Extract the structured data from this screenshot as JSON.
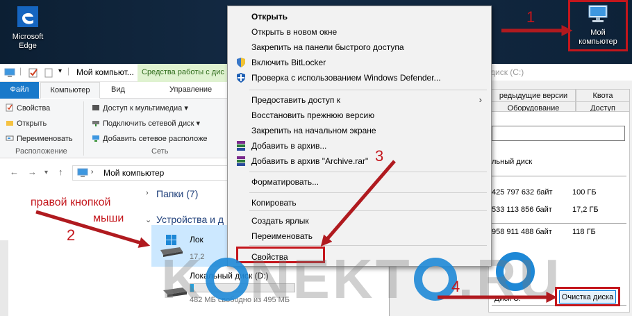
{
  "desktop": {
    "edge_label_line1": "Microsoft",
    "edge_label_line2": "Edge",
    "pc_label_line1": "Мой",
    "pc_label_line2": "компьютер",
    "edge_icon": "edge-icon",
    "pc_icon": "computer-icon"
  },
  "explorer": {
    "title": "Мой компьют...",
    "context_tab": "Средства работы с дис",
    "tabs": [
      "Файл",
      "Компьютер",
      "Вид",
      "Управление"
    ],
    "ribbon": {
      "location": [
        "Свойства",
        "Открыть",
        "Переименовать"
      ],
      "location_group": "Расположение",
      "network": [
        "Доступ к мультимедиа",
        "Подключить сетевой диск",
        "Добавить сетевое расположе"
      ],
      "network_group": "Сеть"
    },
    "address": "Мой компьютер",
    "sections": {
      "folders": "Папки (7)",
      "devices": "Устройства и д"
    },
    "drives": [
      {
        "name": "Лок",
        "info": "17,2",
        "fill": 0.83
      },
      {
        "name": "Локальный диск (D:)",
        "info": "482 МБ свободно из 495 МБ",
        "fill": 0.03
      }
    ]
  },
  "properties": {
    "title": "диск (C:)",
    "tabs_row1": [
      "редыдущие версии",
      "Квота"
    ],
    "tabs_row2": [
      "Оборудование",
      "Доступ"
    ],
    "type_label": "льный диск",
    "rows": [
      {
        "bytes": "425 797 632 байт",
        "size": "100 ГБ"
      },
      {
        "bytes": "533 113 856 байт",
        "size": "17,2 ГБ"
      },
      {
        "bytes": "958 911 488 байт",
        "size": "118 ГБ"
      }
    ],
    "disk_label": "Диск С:",
    "cleanup_button": "Очистка диска"
  },
  "context_menu": {
    "items": [
      {
        "label": "Открыть",
        "bold": true
      },
      {
        "label": "Открыть в новом окне"
      },
      {
        "label": "Закрепить на панели быстрого доступа"
      },
      {
        "label": "Включить BitLocker",
        "icon": "shield-icon"
      },
      {
        "label": "Проверка с использованием Windows Defender...",
        "icon": "defender-icon"
      },
      {
        "label": "Предоставить доступ к",
        "submenu": true
      },
      {
        "label": "Восстановить прежнюю версию"
      },
      {
        "label": "Закрепить на начальном экране"
      },
      {
        "label": "Добавить в архив...",
        "icon": "winrar-icon"
      },
      {
        "label": "Добавить в архив \"Archive.rar\"",
        "icon": "winrar-icon"
      },
      {
        "label": "Форматировать..."
      },
      {
        "label": "Копировать"
      },
      {
        "label": "Создать ярлык"
      },
      {
        "label": "Переименовать"
      },
      {
        "label": "Свойства"
      }
    ],
    "submenu_glyph": "›"
  },
  "annotations": {
    "step1": "1",
    "step2": "2",
    "step3": "3",
    "step4": "4",
    "right_click_line1": "правой кнопкой",
    "right_click_line2": "мыши",
    "accent_color": "#c4161c"
  },
  "watermark": {
    "part1": "K",
    "part2": "NEKT",
    "part3": ".RU"
  }
}
